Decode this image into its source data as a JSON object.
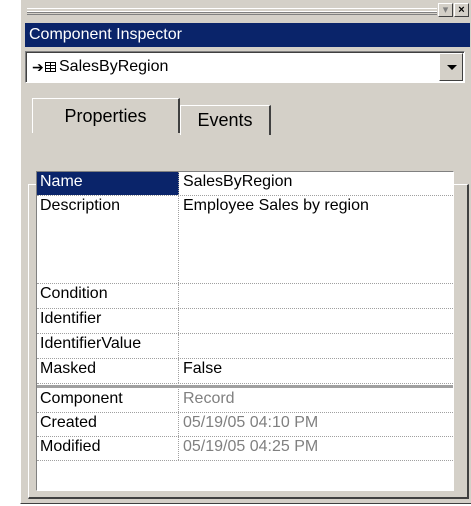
{
  "title": "Component Inspector",
  "selector": {
    "value": "SalesByRegion",
    "arrow_icon": "arrow-right-icon",
    "type_icon": "table-icon"
  },
  "tabs": [
    {
      "label": "Properties",
      "active": true
    },
    {
      "label": "Events",
      "active": false
    }
  ],
  "properties": [
    {
      "name": "Name",
      "value": "SalesByRegion",
      "selected": true
    },
    {
      "name": "Description",
      "value": "Employee Sales by region"
    },
    {
      "name": "Condition",
      "value": ""
    },
    {
      "name": "Identifier",
      "value": ""
    },
    {
      "name": "IdentifierValue",
      "value": ""
    },
    {
      "name": "Masked",
      "value": "False"
    }
  ],
  "info": [
    {
      "name": "Component",
      "value": "Record"
    },
    {
      "name": "Created",
      "value": "05/19/05 04:10 PM"
    },
    {
      "name": "Modified",
      "value": "05/19/05 04:25 PM"
    }
  ],
  "colors": {
    "title_bar": "#0a246a",
    "panel": "#d4d0c8",
    "readonly_text": "#808080"
  }
}
